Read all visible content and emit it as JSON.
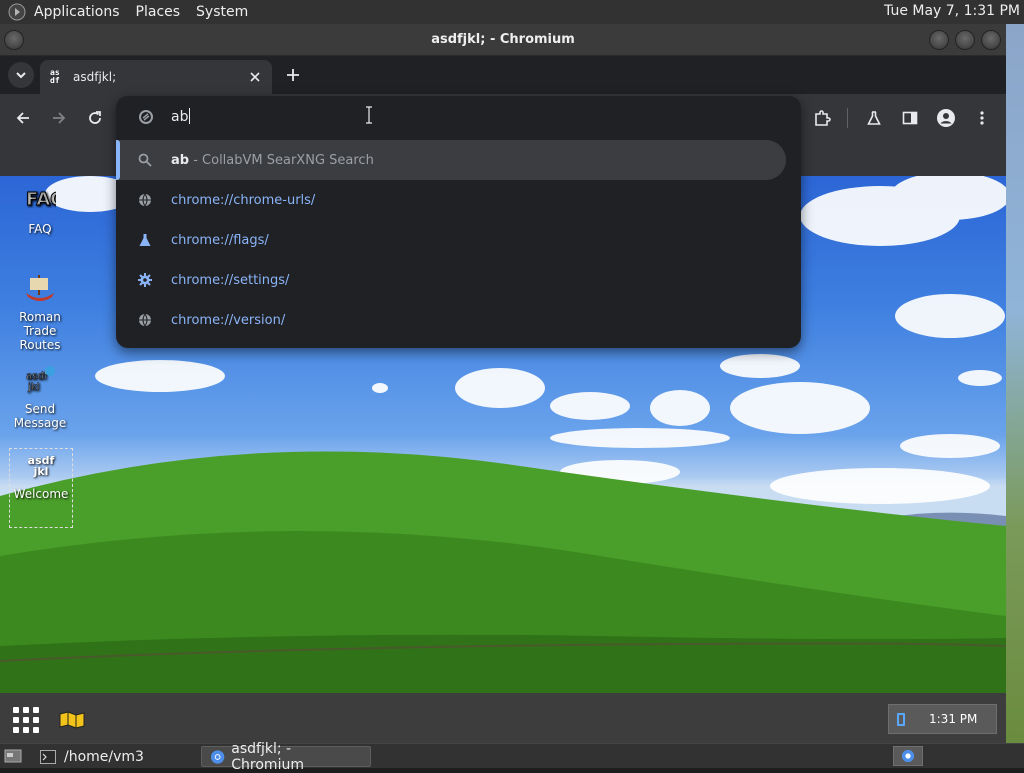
{
  "top_panel": {
    "menus": [
      "Applications",
      "Places",
      "System"
    ],
    "clock": "Tue May 7,  1:31 PM"
  },
  "window": {
    "title": "asdfjkl; - Chromium"
  },
  "tab": {
    "title": "asdfjkl;",
    "favicon_text": "as\ndf"
  },
  "omnibox": {
    "typed": "ab",
    "suggestions": [
      {
        "icon": "search-icon",
        "bold": "ab",
        "rest": " - CollabVM SearXNG Search",
        "selected": true
      },
      {
        "icon": "globe-icon",
        "text": "chrome://chrome-urls/"
      },
      {
        "icon": "flask-icon",
        "text": "chrome://flags/"
      },
      {
        "icon": "gear-icon",
        "text": "chrome://settings/"
      },
      {
        "icon": "globe-icon",
        "text": "chrome://version/"
      }
    ]
  },
  "desktop_icons": [
    {
      "label": "FAQ"
    },
    {
      "label": "Roman\nTrade\nRoutes"
    },
    {
      "label": "Send\nMessage"
    },
    {
      "label": "Welcome",
      "image_text": "asdf\njkl"
    }
  ],
  "dock": {
    "time": "1:31 PM"
  },
  "taskbar": {
    "items": [
      {
        "label": "/home/vm3"
      },
      {
        "label": "asdfjkl; - Chromium",
        "active": true
      }
    ]
  },
  "colors": {
    "accent": "#8ab4f8",
    "omnibox_bg": "#202124",
    "toolbar_bg": "#35363a"
  }
}
